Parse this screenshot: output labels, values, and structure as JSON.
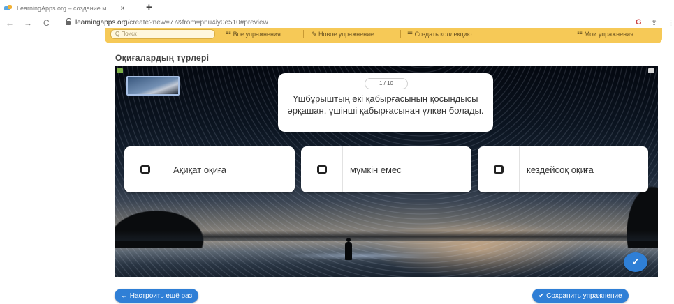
{
  "browser": {
    "tab_title": "LearningApps.org – создание м",
    "tab_close": "×",
    "new_tab": "+",
    "back": "←",
    "forward": "→",
    "reload": "C",
    "url_host": "learningapps.org",
    "url_path": "/create?new=77&from=pnu4iy0e510#preview",
    "g_icon": "G",
    "share_icon": "⇪",
    "more_icon": "⋮"
  },
  "site_toolbar": {
    "search_placeholder": "Q Поиск",
    "all_exercises": "☷ Все упражнения",
    "new_exercise": "✎ Новое упражнение",
    "create_collection": "☰ Создать коллекцию",
    "my_exercises": "☷ Мои упражнения"
  },
  "exercise": {
    "title": "Оқиғалардың түрлері",
    "counter": "1 / 10",
    "question": "Үшбұрыштың екі қабырғасының қосындысы әрқашан, үшінші қабырғасынан үлкен болады.",
    "answers": [
      {
        "label": "Ақиқат оқиға"
      },
      {
        "label": "мүмкін емес"
      },
      {
        "label": "кездейсоқ оқиға"
      }
    ],
    "check_icon": "✓"
  },
  "buttons": {
    "configure_again": "← Настроить ещё раз",
    "save_exercise": "✔ Сохранить упражнение"
  },
  "colors": {
    "accent": "#2f7fd6",
    "toolbar": "#f6c957"
  }
}
